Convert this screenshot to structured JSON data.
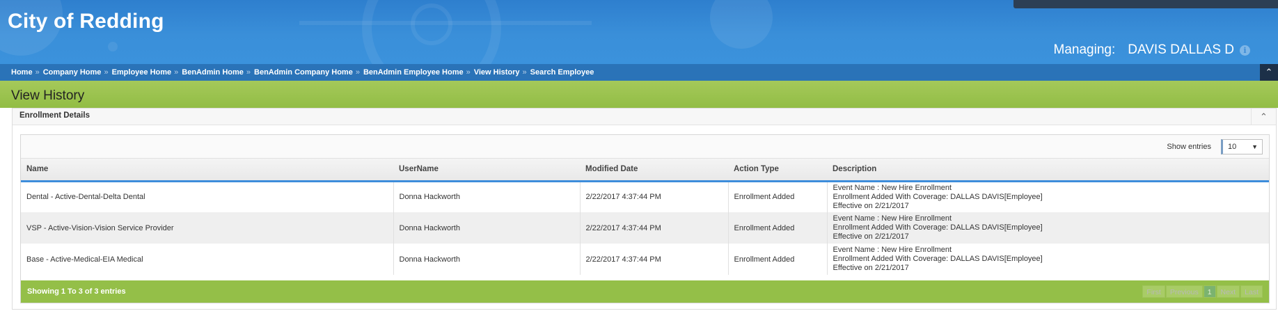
{
  "header": {
    "company_name": "City of Redding",
    "managing_label": "Managing:",
    "managing_name": "DAVIS DALLAS D"
  },
  "breadcrumbs": [
    "Home",
    "Company Home",
    "Employee Home",
    "BenAdmin Home",
    "BenAdmin Company Home",
    "BenAdmin Employee Home",
    "View History",
    "Search Employee"
  ],
  "breadcrumb_separator": "»",
  "page": {
    "title": "View History"
  },
  "panel": {
    "title": "Enrollment Details"
  },
  "table": {
    "show_entries_label": "Show entries",
    "entries_value": "10",
    "columns": [
      "Name",
      "UserName",
      "Modified Date",
      "Action Type",
      "Description"
    ],
    "rows": [
      {
        "name": "Dental - Active-Dental-Delta Dental",
        "username": "Donna Hackworth",
        "modified": "2/22/2017 4:37:44 PM",
        "action": "Enrollment Added",
        "desc": [
          "Event Name : New Hire Enrollment",
          "Enrollment Added With Coverage: DALLAS DAVIS[Employee]",
          "Effective on 2/21/2017"
        ]
      },
      {
        "name": "VSP - Active-Vision-Vision Service Provider",
        "username": "Donna Hackworth",
        "modified": "2/22/2017 4:37:44 PM",
        "action": "Enrollment Added",
        "desc": [
          "Event Name : New Hire Enrollment",
          "Enrollment Added With Coverage: DALLAS DAVIS[Employee]",
          "Effective on 2/21/2017"
        ]
      },
      {
        "name": "Base - Active-Medical-EIA Medical",
        "username": "Donna Hackworth",
        "modified": "2/22/2017 4:37:44 PM",
        "action": "Enrollment Added",
        "desc": [
          "Event Name : New Hire Enrollment",
          "Enrollment Added With Coverage: DALLAS DAVIS[Employee]",
          "Effective on 2/21/2017"
        ]
      }
    ],
    "footer_info": "Showing 1 To 3 of 3 entries",
    "pager": {
      "first": "First",
      "previous": "Previous",
      "current": "1",
      "next": "Next",
      "last": "Last"
    }
  },
  "colors": {
    "header_blue": "#3a8fd9",
    "breadcrumb_blue": "#2a73b8",
    "title_green": "#9cc44f",
    "footer_green": "#94bf48",
    "header_underline": "#3d8ddb"
  },
  "icons": {
    "info": "info-icon",
    "collapse": "chevron-up-icon",
    "dropdown": "caret-down-icon"
  }
}
